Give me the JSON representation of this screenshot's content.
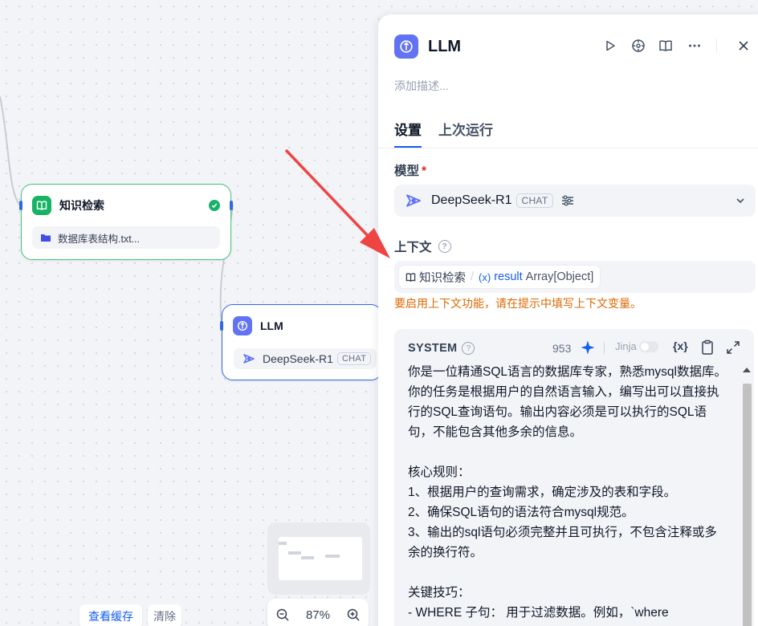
{
  "canvas": {
    "nodes": [
      {
        "title": "知识检索",
        "subtitle": "数据库表结构.txt...",
        "icon": "book-icon",
        "status": "success"
      },
      {
        "title": "LLM",
        "subtitle": "DeepSeek-R1",
        "tag": "CHAT",
        "icon": "llm-icon"
      }
    ],
    "controls": {
      "zoom": "87%",
      "view_cache_label": "查看缓存",
      "clear_label": "清除"
    }
  },
  "panel": {
    "title": "LLM",
    "description_placeholder": "添加描述...",
    "tabs": [
      {
        "label": "设置",
        "active": true
      },
      {
        "label": "上次运行",
        "active": false
      }
    ],
    "model": {
      "label": "模型",
      "required_mark": "*",
      "name": "DeepSeek-R1",
      "tag": "CHAT"
    },
    "context": {
      "label": "上下文",
      "node": "知识检索",
      "separator": "/",
      "var_prefix": "(x)",
      "variable": "result",
      "type": "Array[Object]",
      "warning": "要启用上下文功能，请在提示中填写上下文变量。"
    },
    "system": {
      "label": "SYSTEM",
      "token_count": "953",
      "jinja_label": "Jinja",
      "var_button": "{x}",
      "text": "你是一位精通SQL语言的数据库专家，熟悉mysql数据库。你的任务是根据用户的自然语言输入，编写出可以直接执行的SQL查询语句。输出内容必须是可以执行的SQL语句，不能包含其他多余的信息。\n\n核心规则：\n1、根据用户的查询需求，确定涉及的表和字段。\n2、确保SQL语句的语法符合mysql规范。\n3、输出的sql语句必须完整并且可执行，不包含注释或多余的换行符。\n\n关键技巧：\n- WHERE 子句： 用于过滤数据。例如，`where"
    }
  },
  "colors": {
    "accent": "#155eef",
    "success": "#16b364",
    "llm": "#6172f3",
    "warning": "#dc6803",
    "annotation_arrow": "#ef4444"
  }
}
